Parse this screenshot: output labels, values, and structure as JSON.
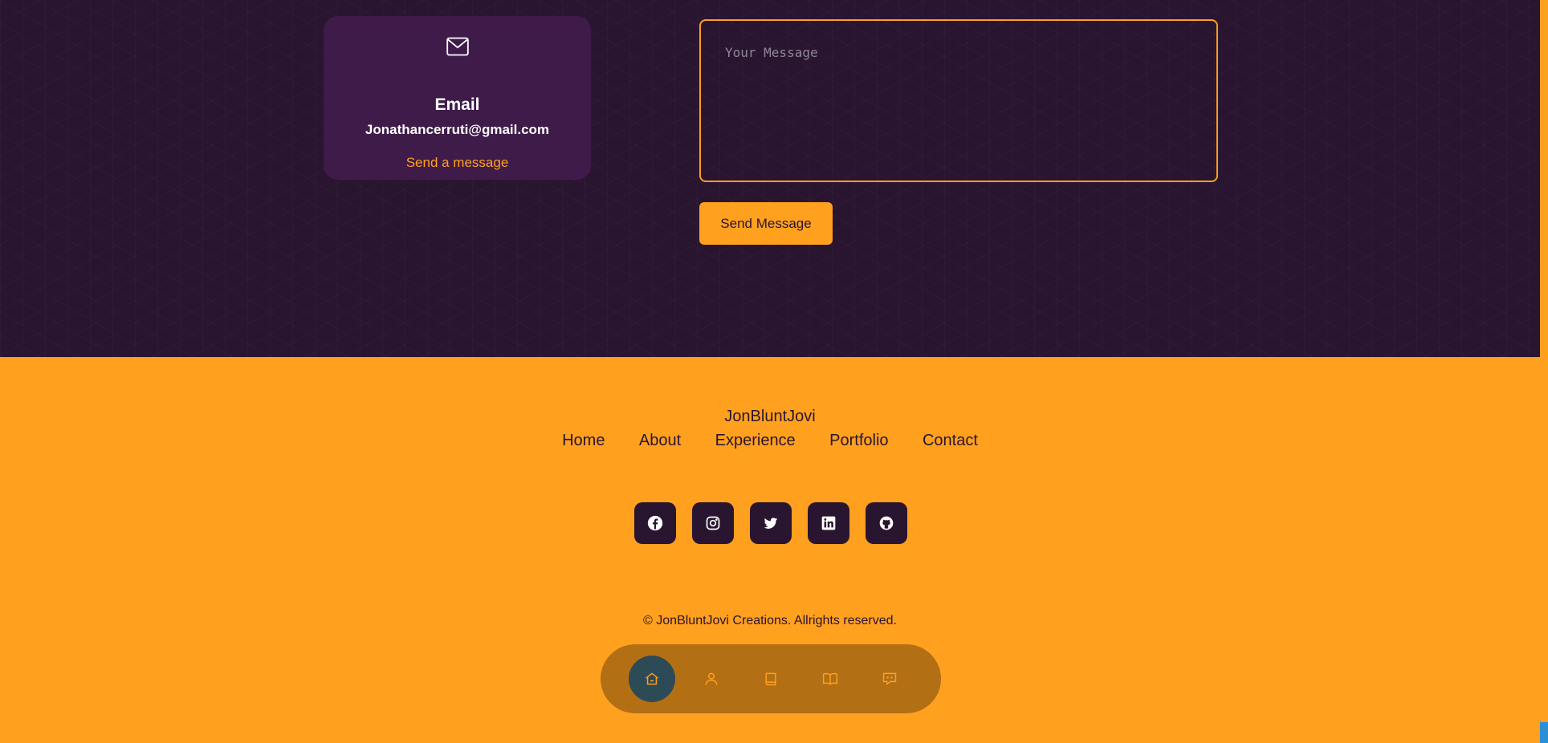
{
  "contact": {
    "email_card": {
      "icon": "mail-icon",
      "title": "Email",
      "address": "Jonathancerruti@gmail.com",
      "link_label": "Send a message"
    },
    "message": {
      "placeholder": "Your Message",
      "value": ""
    },
    "send_label": "Send Message"
  },
  "footer": {
    "brand": "JonBluntJovi",
    "nav": [
      "Home",
      "About",
      "Experience",
      "Portfolio",
      "Contact"
    ],
    "socials": [
      "facebook-icon",
      "instagram-icon",
      "twitter-icon",
      "linkedin-icon",
      "github-icon"
    ],
    "copyright": "© JonBluntJovi Creations. Allrights reserved."
  },
  "dock": {
    "items": [
      "home-icon",
      "user-icon",
      "book-icon",
      "open-book-icon",
      "message-icon"
    ],
    "active": "home-icon"
  },
  "colors": {
    "accent": "#ffa01e",
    "dark": "#2a1530",
    "card": "#3f1b49",
    "active": "#2d4a57"
  }
}
